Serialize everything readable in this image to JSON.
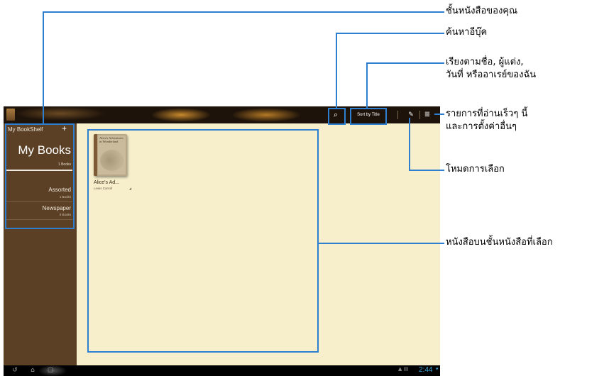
{
  "app": {
    "toolbar": {
      "sort_label": "Sort by Title",
      "search_icon": "search-icon",
      "edit_icon": "pencil-icon",
      "menu_icon": "menu-icon"
    },
    "sidebar": {
      "header": "My BookShelf",
      "add": "+",
      "current_shelf": "My Books",
      "current_count": "1 Books",
      "shelves": [
        {
          "name": "Assorted",
          "count": "1 Books"
        },
        {
          "name": "Newspaper",
          "count": "0 Books"
        }
      ]
    },
    "book": {
      "cover_text": "Alice's Adventures in Wonderland",
      "title": "Alice's Ad...",
      "author": "Lewis Carroll",
      "download_icon": "◢"
    },
    "navbar": {
      "back": "↺",
      "home": "⌂",
      "recent": "▢",
      "time": "2:44"
    }
  },
  "annotations": {
    "bookshelf": "ชั้นหนังสือของคุณ",
    "search": "ค้นหาอีบุ๊ค",
    "sort": "เรียงตามชื่อ, ผู้แต่ง,\nวันที่ หรืออาเรย์ของฉัน",
    "menu": "รายการที่อ่านเร็วๆ นี้\nและการตั้งค่าอื่นๆ",
    "select_mode": "โหมดการเลือก",
    "books_on_shelf": "หนังสือบนชั้นหนังสือที่เลือก"
  },
  "colors": {
    "annotation_blue": "#2f7fd1",
    "shelf_brown": "#5b4026",
    "page_cream": "#f7efcb",
    "clock_blue": "#39a6d8"
  }
}
